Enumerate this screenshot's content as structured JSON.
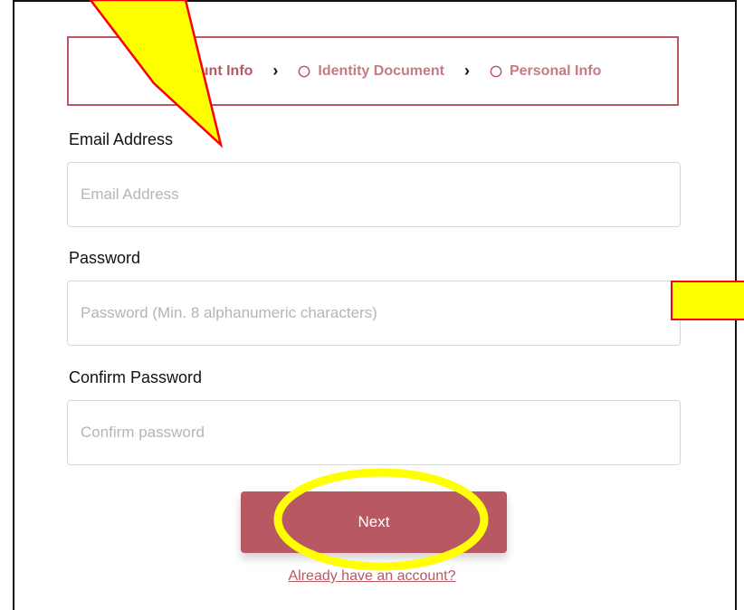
{
  "stepper": {
    "steps": [
      {
        "label": "Account Info",
        "icon": "user-circle-icon",
        "state": "active"
      },
      {
        "label": "Identity Document",
        "icon": "empty-circle-icon",
        "state": "pending"
      },
      {
        "label": "Personal Info",
        "icon": "empty-circle-icon",
        "state": "pending"
      }
    ],
    "separator_icon": "chevron-right-icon",
    "accent_color": "#b75863"
  },
  "form": {
    "email": {
      "label": "Email Address",
      "placeholder": "Email Address",
      "value": ""
    },
    "password": {
      "label": "Password",
      "placeholder": "Password (Min. 8 alphanumeric characters)",
      "value": ""
    },
    "confirm_password": {
      "label": "Confirm Password",
      "placeholder": "Confirm password",
      "value": ""
    },
    "next_label": "Next",
    "login_link": "Already have an account?"
  },
  "annotations": {
    "highlight_color": "#ffff00",
    "outline_color": "#ff0000"
  }
}
